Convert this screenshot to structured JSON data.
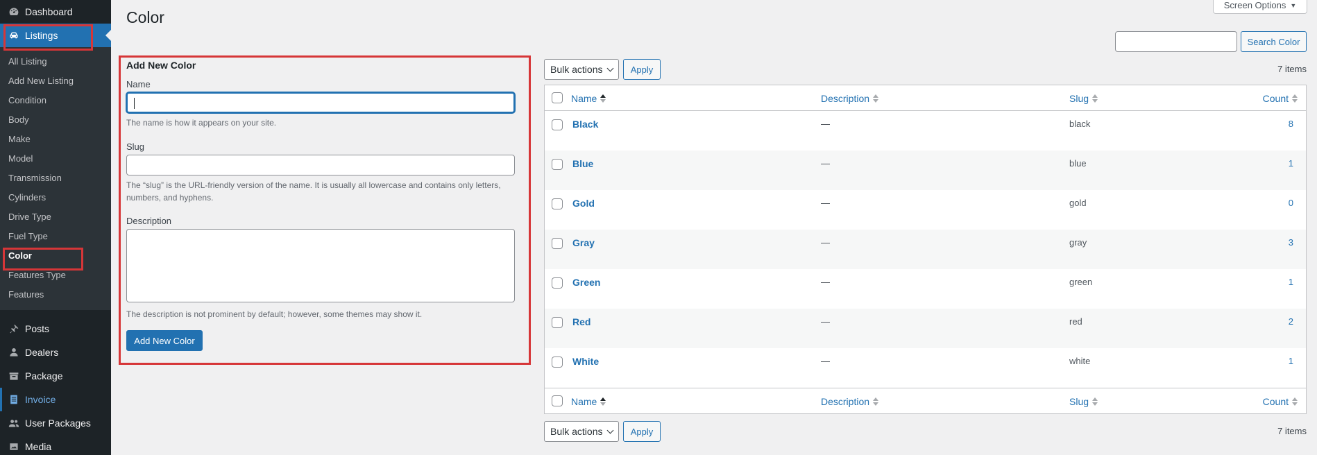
{
  "sidebar": {
    "dashboard": "Dashboard",
    "listings": "Listings",
    "submenu": [
      "All Listing",
      "Add New Listing",
      "Condition",
      "Body",
      "Make",
      "Model",
      "Transmission",
      "Cylinders",
      "Drive Type",
      "Fuel Type",
      "Color",
      "Features Type",
      "Features"
    ],
    "posts": "Posts",
    "dealers": "Dealers",
    "package": "Package",
    "invoice": "Invoice",
    "user_packages": "User Packages",
    "media": "Media"
  },
  "page": {
    "title": "Color",
    "screen_options": "Screen Options",
    "search_button": "Search Color",
    "search_value": ""
  },
  "form": {
    "heading": "Add New Color",
    "name_label": "Name",
    "name_hint": "The name is how it appears on your site.",
    "slug_label": "Slug",
    "slug_hint": "The “slug” is the URL-friendly version of the name. It is usually all lowercase and contains only letters, numbers, and hyphens.",
    "desc_label": "Description",
    "desc_hint": "The description is not prominent by default; however, some themes may show it.",
    "submit": "Add New Color"
  },
  "table": {
    "bulk_actions": "Bulk actions",
    "apply": "Apply",
    "items_count": "7 items",
    "columns": {
      "name": "Name",
      "description": "Description",
      "slug": "Slug",
      "count": "Count"
    },
    "rows": [
      {
        "name": "Black",
        "description": "—",
        "slug": "black",
        "count": "8"
      },
      {
        "name": "Blue",
        "description": "—",
        "slug": "blue",
        "count": "1"
      },
      {
        "name": "Gold",
        "description": "—",
        "slug": "gold",
        "count": "0"
      },
      {
        "name": "Gray",
        "description": "—",
        "slug": "gray",
        "count": "3"
      },
      {
        "name": "Green",
        "description": "—",
        "slug": "green",
        "count": "1"
      },
      {
        "name": "Red",
        "description": "—",
        "slug": "red",
        "count": "2"
      },
      {
        "name": "White",
        "description": "—",
        "slug": "white",
        "count": "1"
      }
    ]
  },
  "colors": {
    "accent": "#2271b1",
    "sidebar": "#1d2327",
    "highlight": "#d63638"
  }
}
